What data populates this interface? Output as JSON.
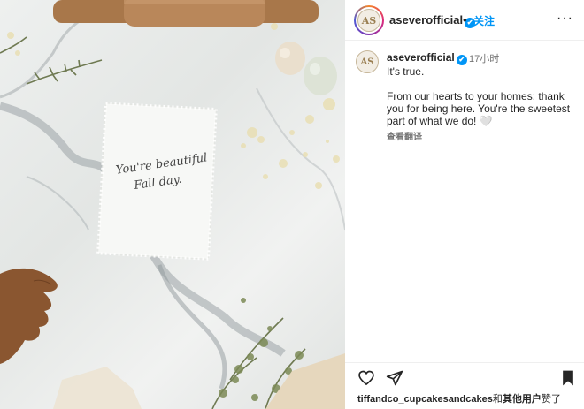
{
  "post": {
    "account": "aseverofficial",
    "separator": "•",
    "follow_label": "关注",
    "more_label": "···",
    "avatar_monogram": "AS"
  },
  "caption": {
    "account": "aseverofficial",
    "time": "17小时",
    "line1": "It's true.",
    "line2": "From our hearts to your homes: thank you for being here. You're the sweetest part of what we do!",
    "heart": "🤍",
    "translate_label": "查看翻译"
  },
  "photo": {
    "note_line1": "You're beautiful",
    "note_line2": "Fall day."
  },
  "likes": {
    "user": "tiffandco_cupcakesandcakes",
    "conj": "和",
    "others": "其他用户",
    "verb": "赞了"
  },
  "colors": {
    "accent": "#0095f6",
    "text": "#262626",
    "muted": "#737373"
  },
  "icons": [
    "heart-icon",
    "share-icon",
    "bookmark-icon",
    "more-icon",
    "verified-icon"
  ]
}
